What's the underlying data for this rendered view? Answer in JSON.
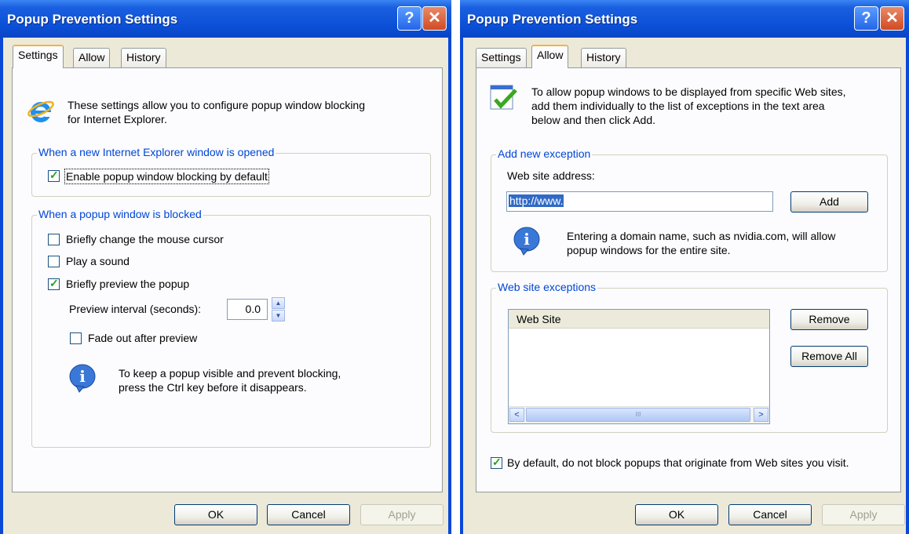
{
  "left": {
    "title": "Popup Prevention Settings",
    "tabs": [
      "Settings",
      "Allow",
      "History"
    ],
    "intro_line1": "These settings allow you to configure popup window blocking",
    "intro_line2": "for Internet Explorer.",
    "group1_label": "When a new Internet Explorer window is opened",
    "enable_blocking_label": "Enable popup window blocking by default",
    "group2_label": "When a popup window is blocked",
    "change_cursor_label": "Briefly change the mouse cursor",
    "play_sound_label": "Play a sound",
    "preview_popup_label": "Briefly preview the popup",
    "preview_interval_label": "Preview interval (seconds):",
    "preview_interval_value": "0.0",
    "fade_out_label": "Fade out after preview",
    "tip_line1": "To keep a popup visible and prevent blocking,",
    "tip_line2": "press the Ctrl key before it disappears.",
    "checkboxes": {
      "enable_blocking": true,
      "change_cursor": false,
      "play_sound": false,
      "preview_popup": true,
      "fade_out": false
    }
  },
  "right": {
    "title": "Popup Prevention Settings",
    "tabs": [
      "Settings",
      "Allow",
      "History"
    ],
    "intro_line1": "To allow popup windows to be displayed from specific Web sites,",
    "intro_line2": "add them individually to the list of exceptions in the text area",
    "intro_line3": "below and then click Add.",
    "group1_label": "Add new exception",
    "address_label": "Web site address:",
    "address_value": "http://www.",
    "add_button": "Add",
    "info_line1": "Entering a domain name, such as nvidia.com, will allow",
    "info_line2": "popup windows for the entire site.",
    "group2_label": "Web site exceptions",
    "list_header": "Web Site",
    "remove_button": "Remove",
    "remove_all_button": "Remove All",
    "default_allow_label": "By default, do not block popups that originate from Web sites you visit.",
    "default_allow_checked": true
  },
  "buttons": {
    "ok": "OK",
    "cancel": "Cancel",
    "apply": "Apply"
  },
  "icons": {
    "help": "?",
    "close": "✕",
    "info": "i",
    "scroll_left": "<",
    "scroll_right": ">",
    "scroll_grip": "III"
  },
  "colors": {
    "title_bar": "#0b4fd6",
    "group_label": "#0046d5",
    "check": "#21a121",
    "dialog_bg": "#ece9d8"
  }
}
